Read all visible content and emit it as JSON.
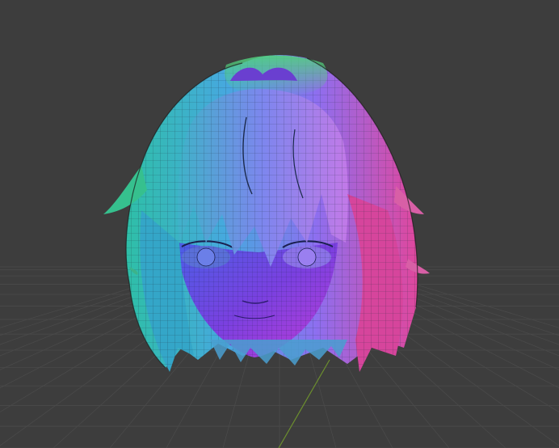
{
  "viewport": {
    "background": "#3d3d3d",
    "grid_color": "#4a4a4a",
    "axis_y_color": "#6c8f2e"
  },
  "model": {
    "shading": "normal-map",
    "wireframe_overlay": true,
    "colors": {
      "left": "#2fb8b0",
      "top": "#3fbf7f",
      "front": "#6f54e6",
      "right": "#e04aa8",
      "bottom": "#5a2fd8"
    }
  }
}
